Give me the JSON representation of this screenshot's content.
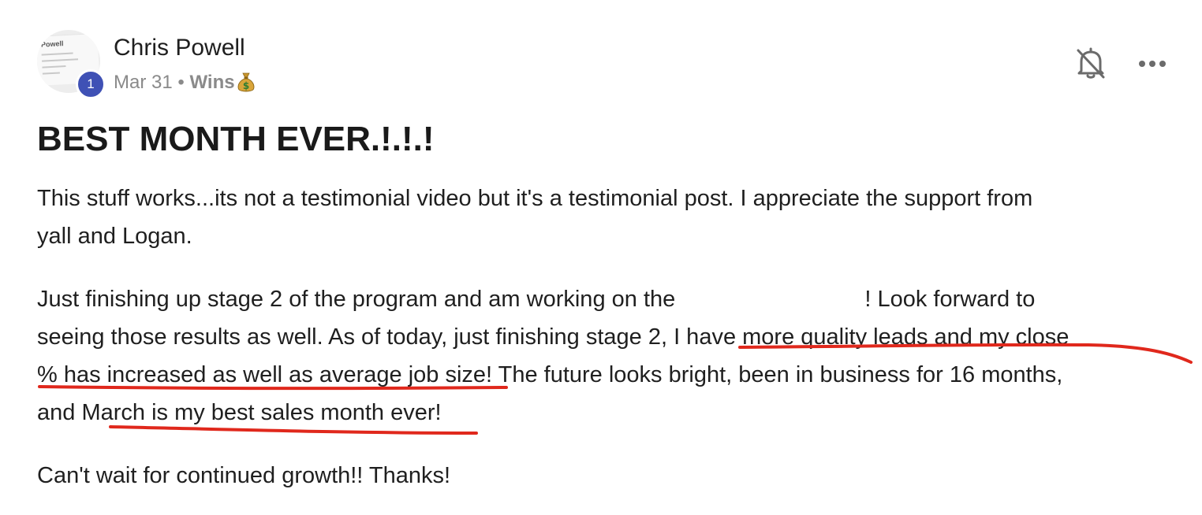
{
  "post": {
    "author": {
      "name": "Chris Powell",
      "level": "1",
      "avatar_card_text": "Powell"
    },
    "date": "Mar 31",
    "separator": "•",
    "category": "Wins",
    "category_icon": "money-bag-icon",
    "actions": {
      "bell_icon": "bell-off-icon",
      "more_icon": "more-horizontal-icon"
    },
    "title": "BEST MONTH EVER.!.!.!",
    "paragraphs": [
      {
        "lines": [
          "This stuff works...its not a testimonial video but it's a testimonial post. I appreciate the support from",
          "yall and Logan."
        ]
      },
      {
        "line1_before": "Just finishing up stage 2 of the program and am working on the",
        "line1_after": "! Look forward to",
        "line2": "seeing those results as well. As of today, just finishing stage 2, I have more quality leads and my close",
        "line3": "% has increased as well as average job size! The future looks bright, been in business for 16 months,",
        "line4": "and March is my best sales month ever!"
      },
      {
        "lines": [
          "Can't wait for continued growth!! Thanks!"
        ]
      }
    ],
    "annotation_color": "#e0281c",
    "accent_color": "#3f51b5"
  }
}
